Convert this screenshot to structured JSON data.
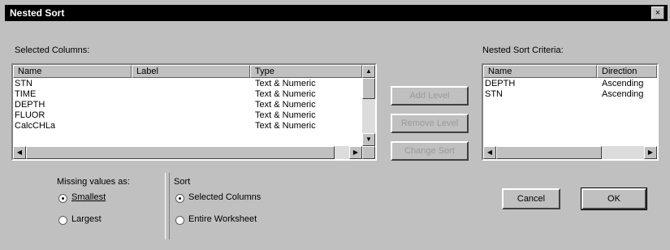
{
  "window": {
    "title": "Nested Sort",
    "close_glyph": "×"
  },
  "selected_columns": {
    "label": "Selected Columns:",
    "headers": [
      "Name",
      "Label",
      "Type"
    ],
    "rows": [
      {
        "name": "STN",
        "label": "",
        "type": "Text & Numeric"
      },
      {
        "name": "TIME",
        "label": "",
        "type": "Text & Numeric"
      },
      {
        "name": "DEPTH",
        "label": "",
        "type": "Text & Numeric"
      },
      {
        "name": "FLUOR",
        "label": "",
        "type": "Text & Numeric"
      },
      {
        "name": "CalcCHLa",
        "label": "",
        "type": "Text & Numeric"
      }
    ]
  },
  "middle_buttons": {
    "add": "Add Level",
    "remove": "Remove Level",
    "change": "Change Sort"
  },
  "nested_sort": {
    "label": "Nested Sort Criteria:",
    "headers": [
      "Name",
      "Direction"
    ],
    "rows": [
      {
        "name": "DEPTH",
        "direction": "Ascending"
      },
      {
        "name": "STN",
        "direction": "Ascending"
      }
    ]
  },
  "missing_values": {
    "label": "Missing values as:",
    "options": [
      "Smallest",
      "Largest"
    ],
    "selected": "Smallest"
  },
  "sort": {
    "label": "Sort",
    "options": [
      "Selected Columns",
      "Entire Worksheet"
    ],
    "selected": "Selected Columns"
  },
  "actions": {
    "cancel": "Cancel",
    "ok": "OK"
  },
  "icons": {
    "up": "▲",
    "down": "▼",
    "left": "◀",
    "right": "▶"
  }
}
